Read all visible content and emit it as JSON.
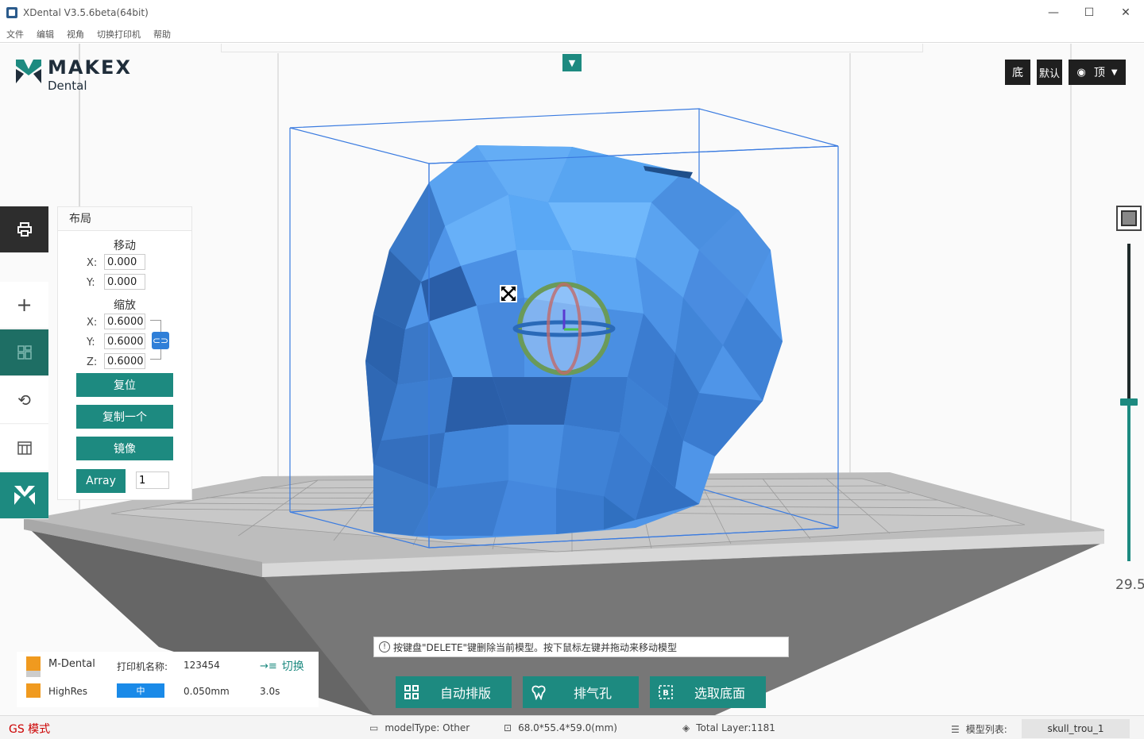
{
  "window": {
    "title": "XDental V3.5.6beta(64bit)",
    "minimize": "—",
    "maximize": "☐",
    "close": "✕"
  },
  "menu": [
    "文件",
    "编辑",
    "视角",
    "切换打印机",
    "帮助"
  ],
  "logo": {
    "brand": "MAKEX",
    "sub": "Dental"
  },
  "colors": {
    "accent": "#1d8a80",
    "model": "#4a90e2",
    "blue_button": "#1a8ae8",
    "orange": "#f09a1f",
    "status_red": "#cc0000"
  },
  "view_buttons": {
    "bottom": "底",
    "default": "默认",
    "top": "顶"
  },
  "left_toolbar": [
    {
      "name": "printer-icon"
    },
    {
      "name": "add-icon"
    },
    {
      "name": "layout-icon"
    },
    {
      "name": "rotate-icon"
    },
    {
      "name": "support-icon"
    },
    {
      "name": "makex-icon"
    }
  ],
  "layout_panel": {
    "title": "布局",
    "move_title": "移动",
    "move": {
      "x_label": "X:",
      "x": "0.000",
      "y_label": "Y:",
      "y": "0.000"
    },
    "scale_title": "缩放",
    "scale": {
      "x_label": "X:",
      "x": "0.6000",
      "y_label": "Y:",
      "y": "0.6000",
      "z_label": "Z:",
      "z": "0.6000"
    },
    "reset": "复位",
    "copy_one": "复制一个",
    "mirror": "镜像",
    "array": "Array",
    "array_count": "1"
  },
  "slider": {
    "value": "29.5",
    "fraction": 0.5
  },
  "hint": "按键盘\"DELETE\"键删除当前模型。按下鼠标左键并拖动来移动模型",
  "actions": {
    "auto_layout": "自动排版",
    "vent_hole": "排气孔",
    "select_base": "选取底面"
  },
  "printer": {
    "name": "M-Dental",
    "name_label": "打印机名称:",
    "name_value": "123454",
    "switch": "切换",
    "material": "HighRes",
    "quality": "中",
    "layer_height": "0.050mm",
    "exposure": "3.0s"
  },
  "status": {
    "mode": "GS 模式",
    "model_type": "modelType: Other",
    "size": "68.0*55.4*59.0(mm)",
    "total_layer": "Total Layer:1181",
    "model_list_label": "模型列表:",
    "model_name": "skull_trou_1"
  }
}
